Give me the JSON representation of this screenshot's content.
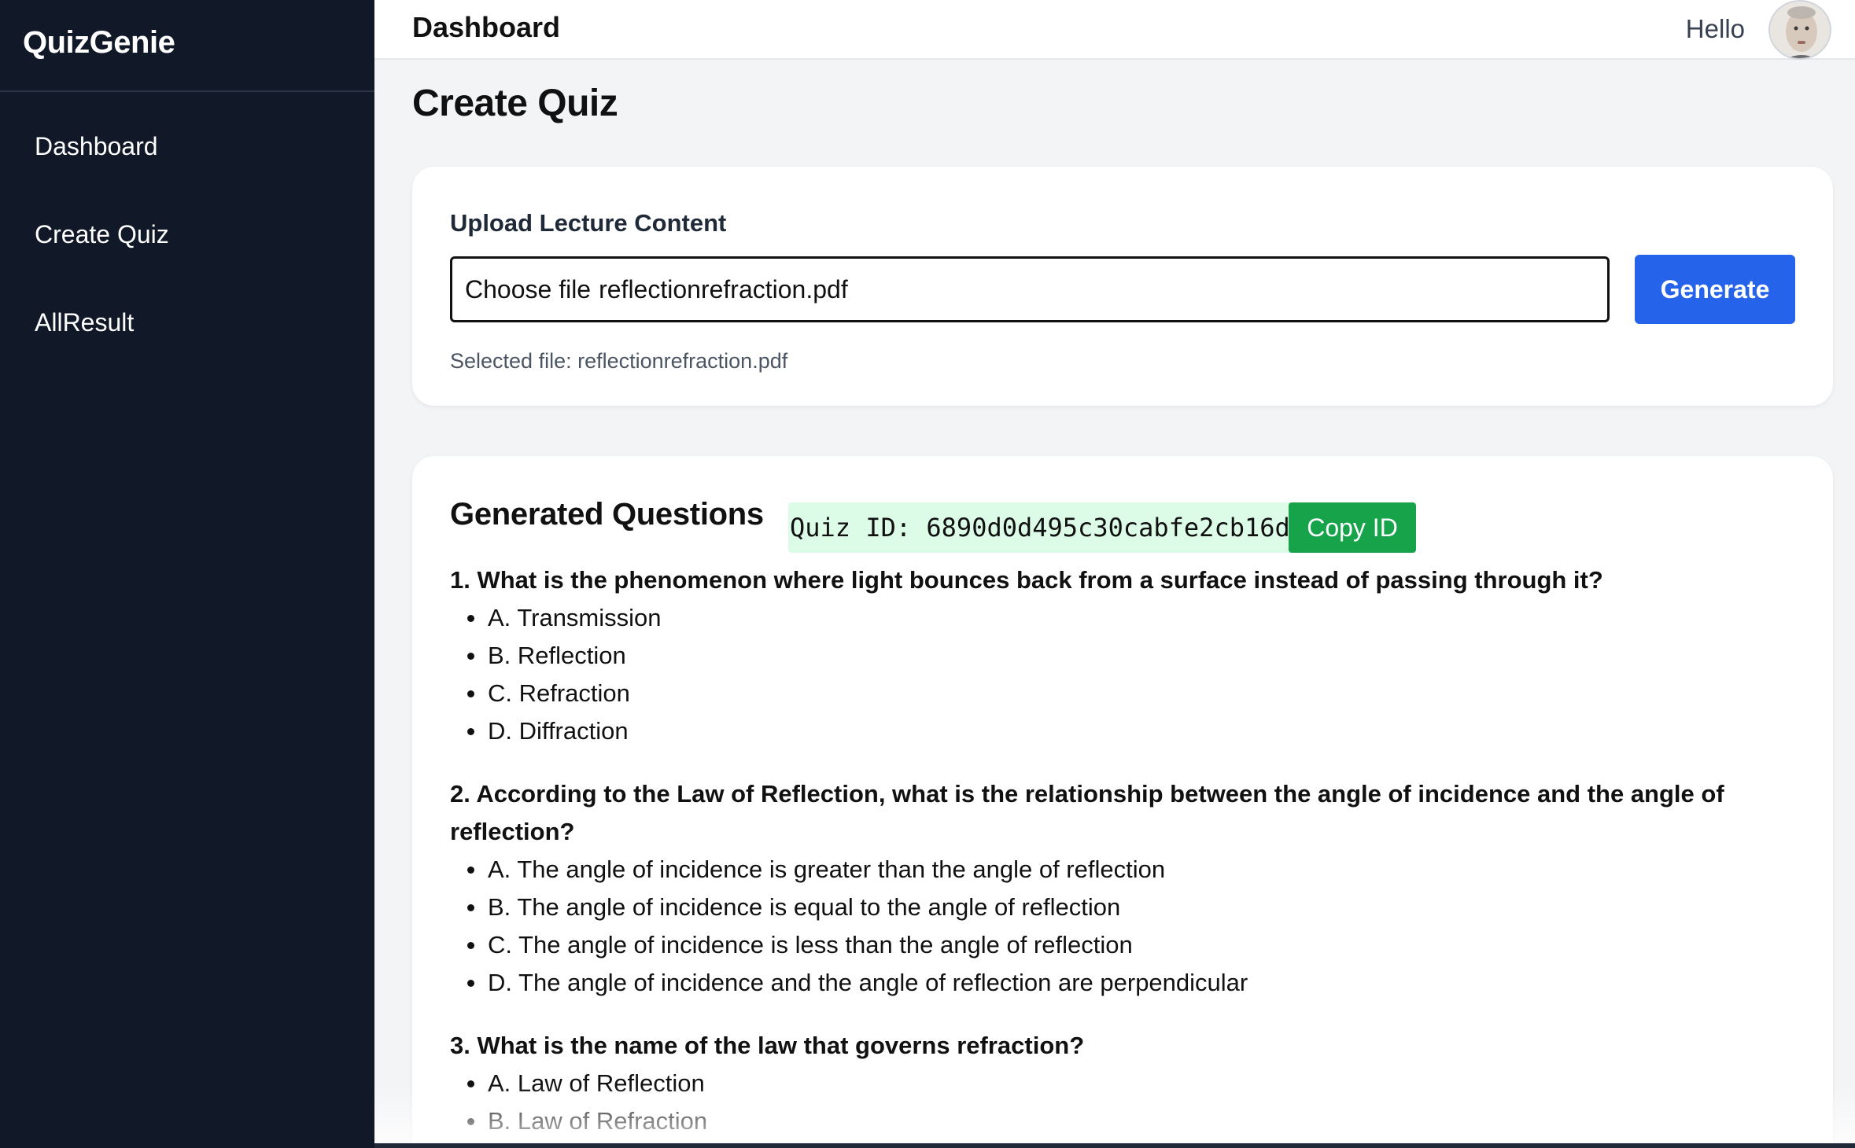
{
  "sidebar": {
    "brand": "QuizGenie",
    "items": [
      {
        "label": "Dashboard"
      },
      {
        "label": "Create Quiz"
      },
      {
        "label": "AllResult"
      }
    ]
  },
  "header": {
    "title": "Dashboard",
    "greeting": "Hello"
  },
  "main": {
    "page_title": "Create Quiz",
    "upload": {
      "label": "Upload Lecture Content",
      "choose_label": "Choose file",
      "file_name": "reflectionrefraction.pdf",
      "generate_label": "Generate",
      "selected_text": "Selected file: reflectionrefraction.pdf"
    },
    "generated": {
      "title": "Generated Questions",
      "quiz_id_text": "Quiz ID: 6890d0d495c30cabfe2cb16d",
      "copy_label": "Copy ID",
      "questions": [
        {
          "text": "1. What is the phenomenon where light bounces back from a surface instead of passing through it?",
          "options": [
            "A. Transmission",
            "B. Reflection",
            "C. Refraction",
            "D. Diffraction"
          ]
        },
        {
          "text": "2. According to the Law of Reflection, what is the relationship between the angle of incidence and the angle of reflection?",
          "options": [
            "A. The angle of incidence is greater than the angle of reflection",
            "B. The angle of incidence is equal to the angle of reflection",
            "C. The angle of incidence is less than the angle of reflection",
            "D. The angle of incidence and the angle of reflection are perpendicular"
          ]
        },
        {
          "text": "3. What is the name of the law that governs refraction?",
          "options": [
            "A. Law of Reflection",
            "B. Law of Refraction"
          ]
        }
      ]
    }
  },
  "colors": {
    "sidebar_bg": "#111827",
    "primary": "#2563eb",
    "success": "#16a34a",
    "id_bg": "#dcfce7"
  }
}
